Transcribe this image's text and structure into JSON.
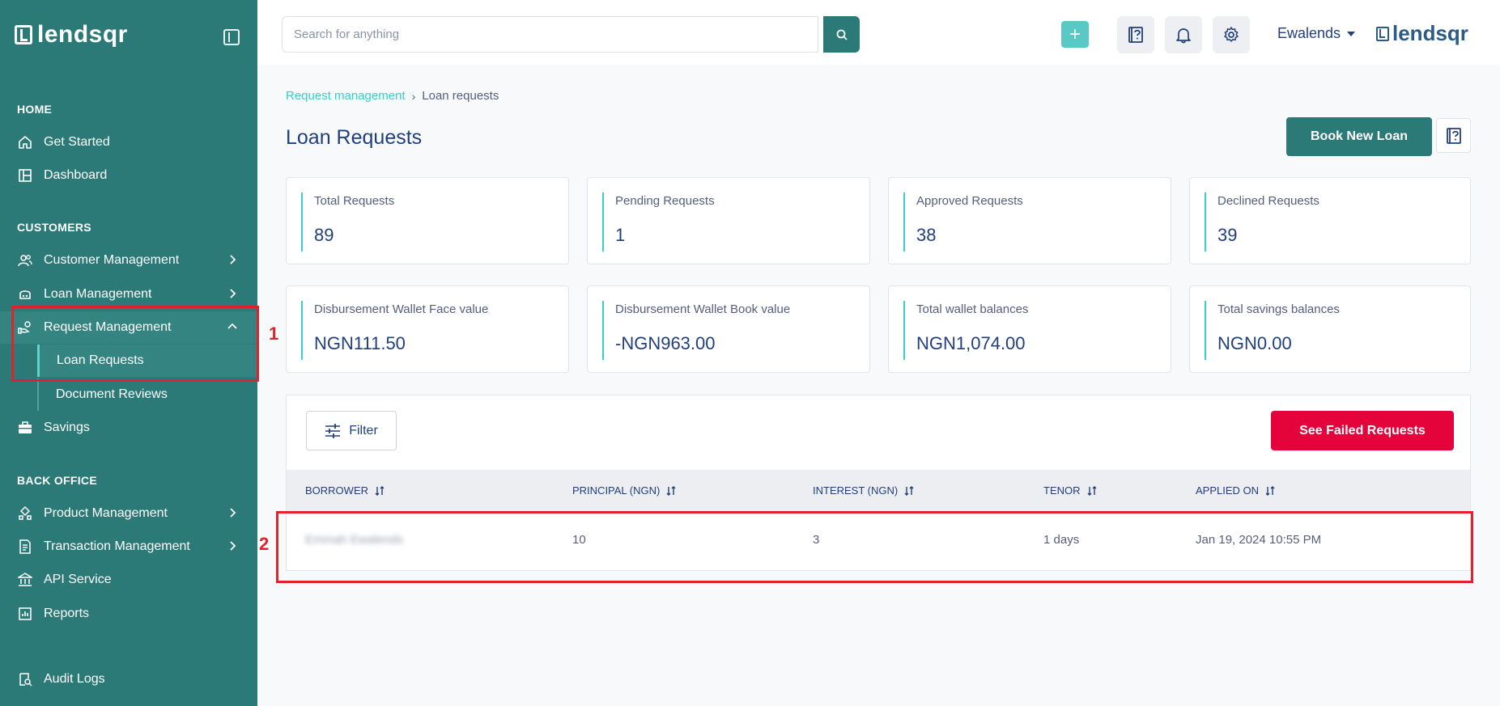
{
  "sidebar": {
    "logo_text": "lendsqr",
    "sections": {
      "home": "HOME",
      "customers": "CUSTOMERS",
      "back_office": "BACK OFFICE"
    },
    "items": {
      "get_started": "Get Started",
      "dashboard": "Dashboard",
      "customer_management": "Customer Management",
      "loan_management": "Loan Management",
      "request_management": "Request Management",
      "loan_requests": "Loan Requests",
      "document_reviews": "Document Reviews",
      "savings": "Savings",
      "product_management": "Product Management",
      "transaction_management": "Transaction Management",
      "api_service": "API Service",
      "reports": "Reports",
      "audit_logs": "Audit Logs"
    }
  },
  "header": {
    "search_placeholder": "Search for anything",
    "plus_label": "+",
    "user_name": "Ewalends",
    "brand_text": "lendsqr"
  },
  "breadcrumb": {
    "parent": "Request management",
    "separator": "›",
    "current": "Loan requests"
  },
  "page": {
    "title": "Loan Requests",
    "book_button": "Book New Loan"
  },
  "stats": {
    "total_requests": {
      "label": "Total Requests",
      "value": "89"
    },
    "pending_requests": {
      "label": "Pending Requests",
      "value": "1"
    },
    "approved_requests": {
      "label": "Approved Requests",
      "value": "38"
    },
    "declined_requests": {
      "label": "Declined Requests",
      "value": "39"
    },
    "face_value": {
      "label": "Disbursement Wallet Face value",
      "value": "NGN111.50"
    },
    "book_value": {
      "label": "Disbursement Wallet Book value",
      "value": "-NGN963.00"
    },
    "wallet_balances": {
      "label": "Total wallet balances",
      "value": "NGN1,074.00"
    },
    "savings_balances": {
      "label": "Total savings balances",
      "value": "NGN0.00"
    }
  },
  "table": {
    "filter_label": "Filter",
    "failed_button": "See Failed Requests",
    "columns": {
      "borrower": "BORROWER",
      "principal": "PRINCIPAL (NGN)",
      "interest": "INTEREST (NGN)",
      "tenor": "TENOR",
      "applied_on": "APPLIED ON"
    },
    "rows": [
      {
        "borrower": "Emmah Ewalends",
        "principal": "10",
        "interest": "3",
        "tenor": "1 days",
        "applied_on": "Jan 19, 2024 10:55 PM"
      }
    ]
  },
  "annotations": {
    "one": "1",
    "two": "2"
  },
  "colors": {
    "sidebar_bg": "#2b7a78",
    "accent": "#39cdcc",
    "primary_text": "#213f7d",
    "danger": "#e4033b",
    "annotation": "#e3212b"
  }
}
